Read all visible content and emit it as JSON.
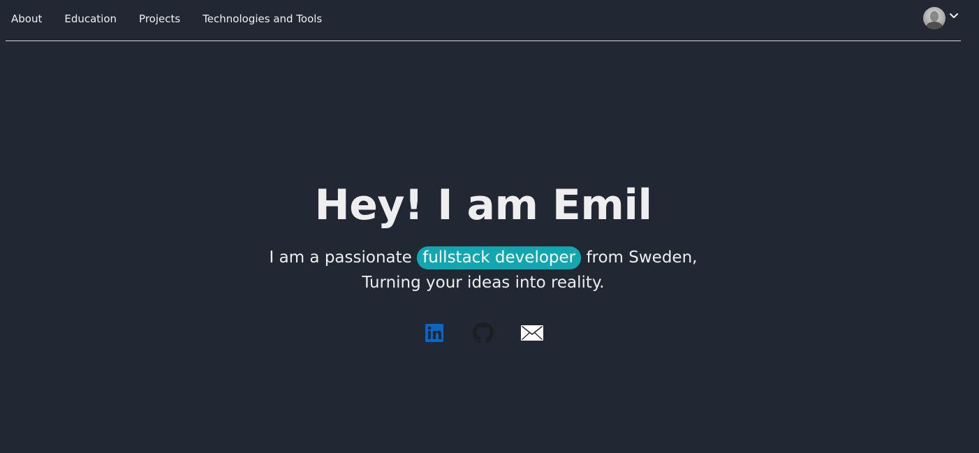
{
  "nav": {
    "items": [
      {
        "label": "About"
      },
      {
        "label": "Education"
      },
      {
        "label": "Projects"
      },
      {
        "label": "Technologies and Tools"
      }
    ]
  },
  "profile": {
    "avatar_icon": "user-avatar",
    "menu_icon": "chevron-down-icon"
  },
  "hero": {
    "title": "Hey! I am Emil",
    "line1_before": "I am a passionate",
    "highlight": "fullstack developer",
    "line1_after": "from Sweden,",
    "line2": "Turning your ideas into reality."
  },
  "socials": [
    {
      "icon": "linkedin-icon",
      "color": "#0a66c2"
    },
    {
      "icon": "github-icon",
      "color": "#1b1f23"
    },
    {
      "icon": "mail-icon",
      "color": "#ffffff"
    }
  ],
  "colors": {
    "background": "#222833",
    "accent": "#12a7b0",
    "text": "#eeeeee"
  }
}
